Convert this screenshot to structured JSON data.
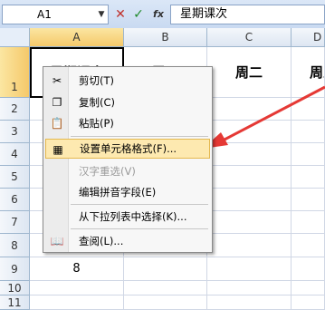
{
  "formula_bar": {
    "cell_ref": "A1",
    "name_dropdown": "▼",
    "cancel": "✕",
    "enter": "✓",
    "fx": "fx",
    "content": "星期课次"
  },
  "columns": [
    "A",
    "B",
    "C",
    "D"
  ],
  "rows": [
    "1",
    "2",
    "3",
    "4",
    "5",
    "6",
    "7",
    "8",
    "9",
    "10",
    "11"
  ],
  "cells": {
    "a1": "星期课次",
    "b1": "周一",
    "c1": "周二",
    "d1": "周三",
    "a9": "8"
  },
  "context_menu": {
    "items": [
      {
        "label": "剪切(T)",
        "icon": "scissors-icon",
        "glyph": "✂"
      },
      {
        "label": "复制(C)",
        "icon": "copy-icon",
        "glyph": "❐"
      },
      {
        "label": "粘贴(P)",
        "icon": "paste-icon",
        "glyph": "📋"
      },
      {
        "label": "设置单元格格式(F)...",
        "icon": "format-cells-icon",
        "glyph": "▦",
        "highlighted": true
      },
      {
        "label": "汉字重选(V)",
        "disabled": true
      },
      {
        "label": "编辑拼音字段(E)"
      },
      {
        "label": "从下拉列表中选择(K)..."
      },
      {
        "label": "查阅(L)...",
        "icon": "research-icon",
        "glyph": "📖"
      }
    ]
  },
  "colors": {
    "arrow": "#e53935",
    "highlight": "#fde9b0"
  }
}
